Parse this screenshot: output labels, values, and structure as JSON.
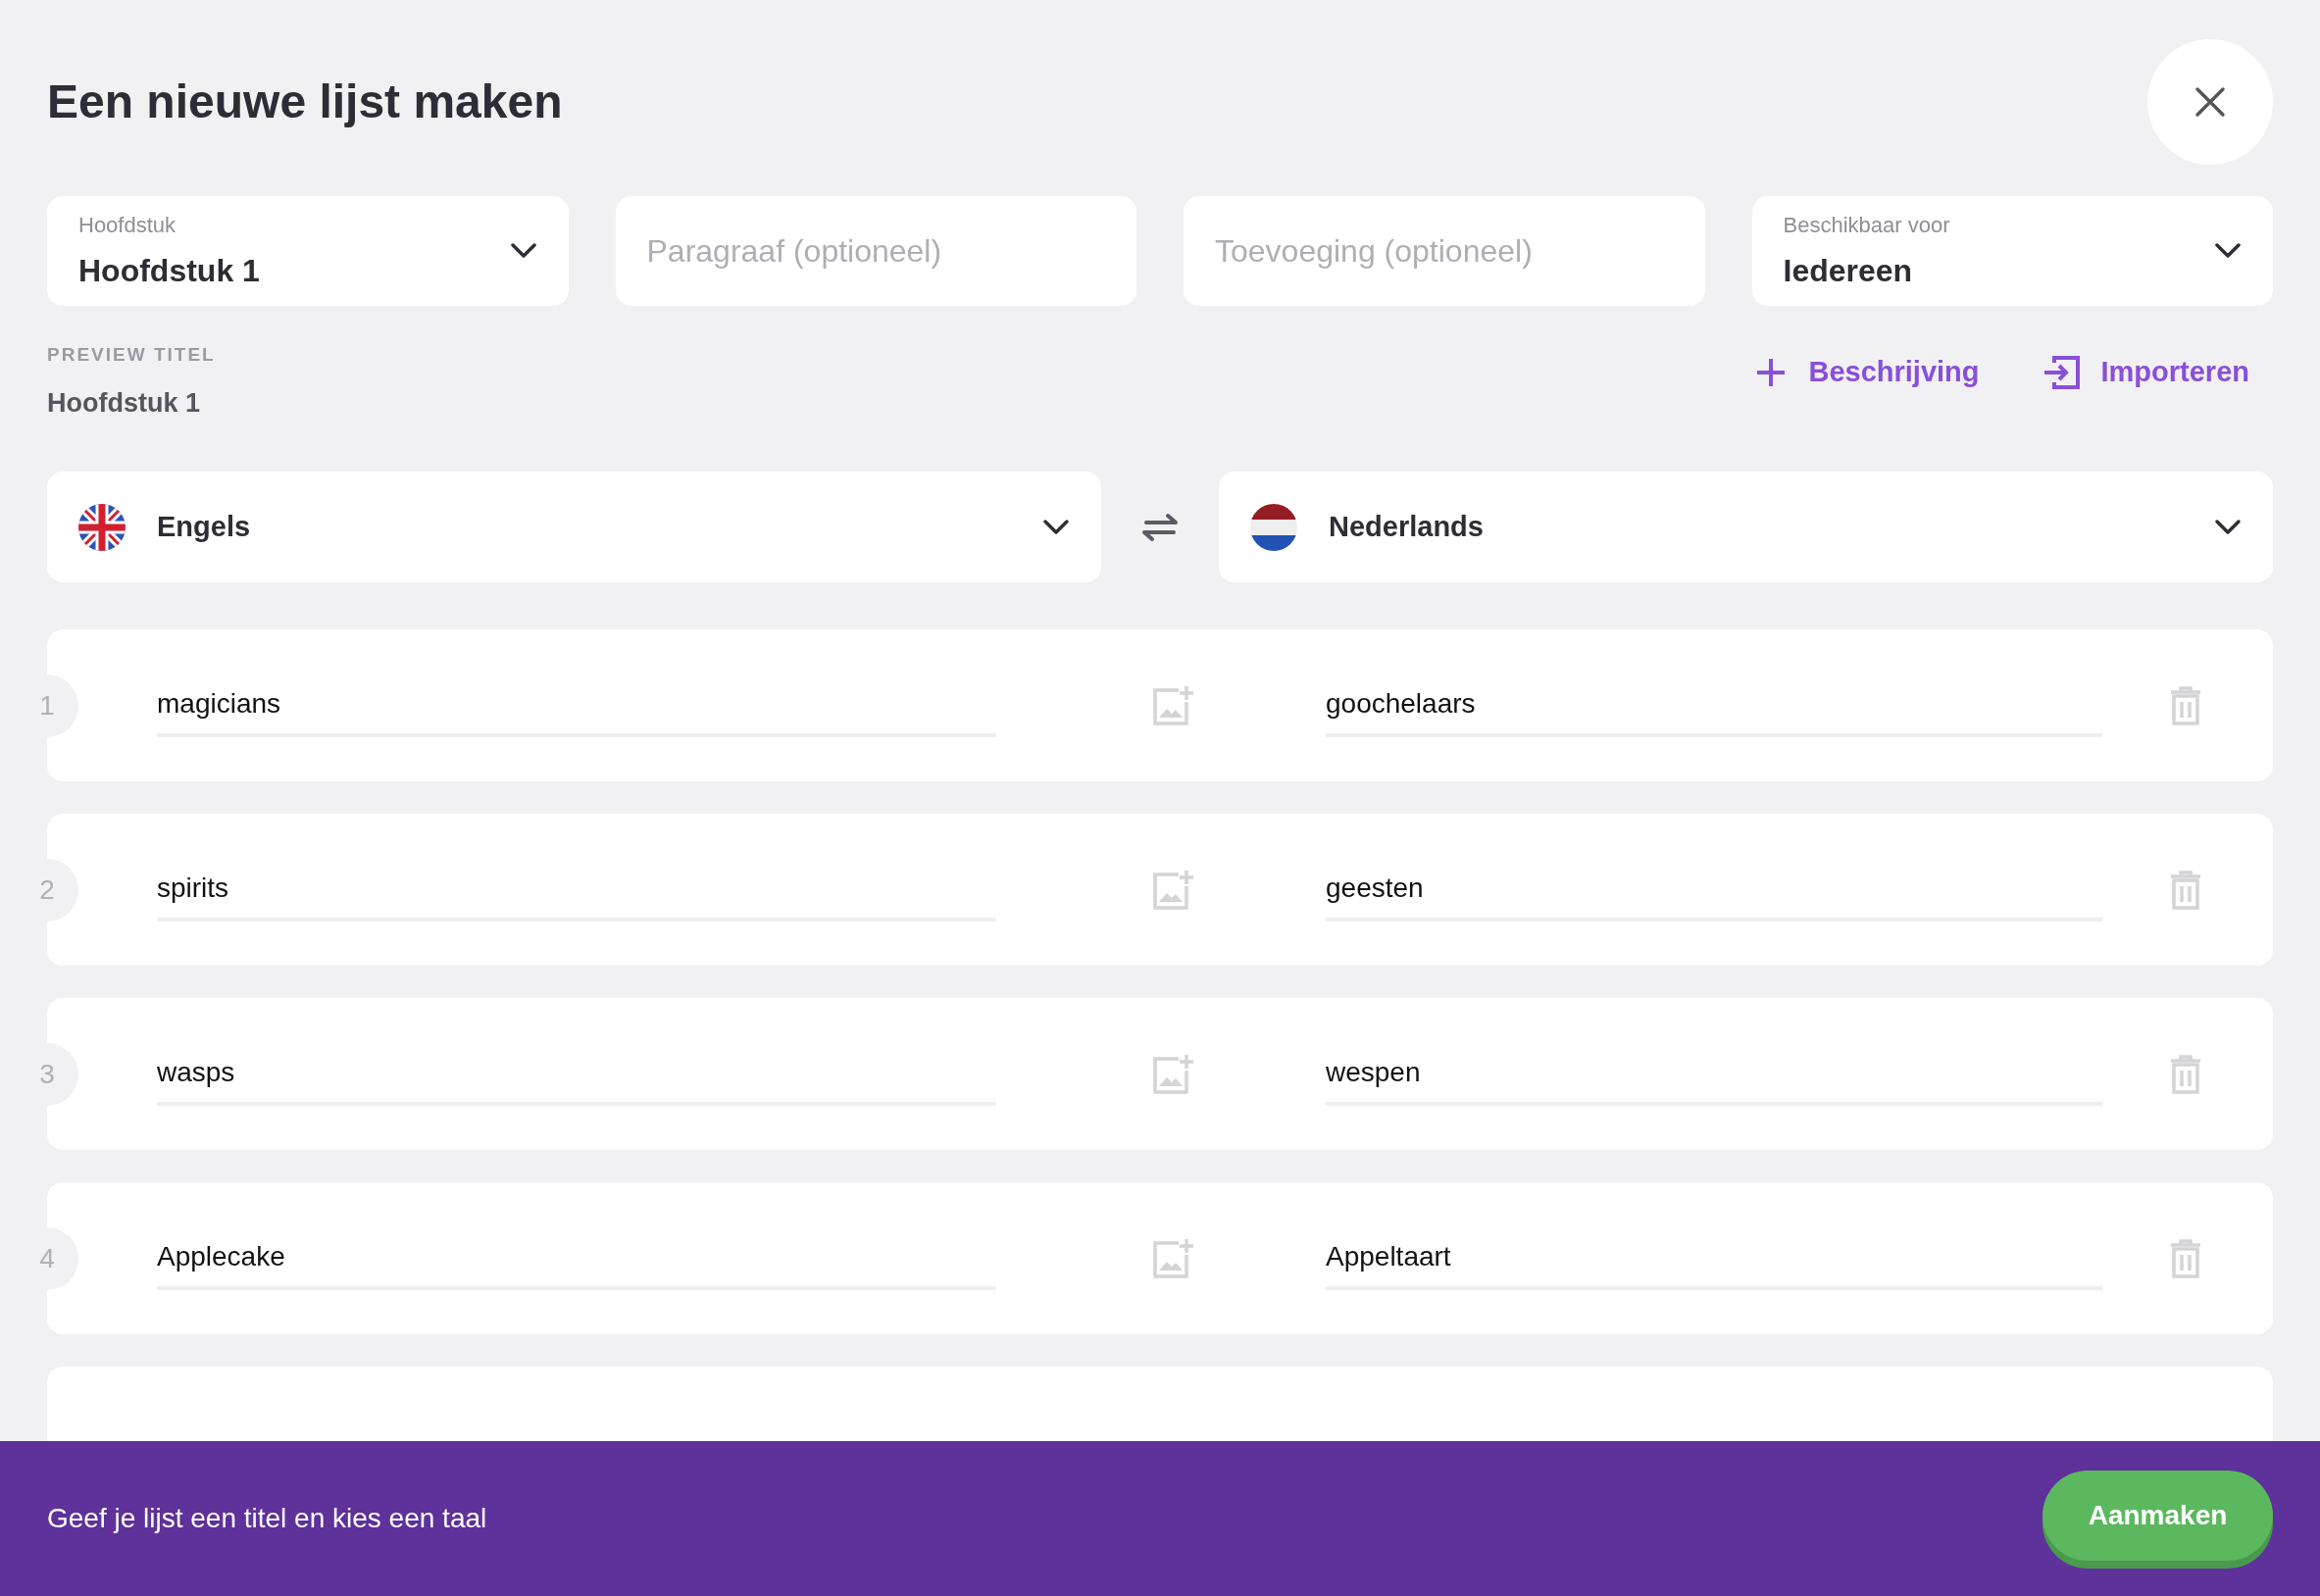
{
  "title": "Een nieuwe lijst maken",
  "fields": [
    {
      "kind": "select",
      "label": "Hoofdstuk",
      "value": "Hoofdstuk 1"
    },
    {
      "kind": "text",
      "placeholder": "Paragraaf (optioneel)"
    },
    {
      "kind": "text",
      "placeholder": "Toevoeging (optioneel)"
    },
    {
      "kind": "select",
      "label": "Beschikbaar voor",
      "value": "Iedereen"
    }
  ],
  "preview": {
    "label": "PREVIEW TITEL",
    "value": "Hoofdstuk 1"
  },
  "actions": [
    {
      "kind": "add",
      "label": "Beschrijving"
    },
    {
      "kind": "import",
      "label": "Importeren"
    }
  ],
  "languages": [
    {
      "kind": "uk",
      "name": "Engels"
    },
    {
      "kind": "nl",
      "name": "Nederlands"
    }
  ],
  "rows": [
    {
      "number": "1",
      "word": "magicians",
      "meaning": "goochelaars"
    },
    {
      "number": "2",
      "word": "spirits",
      "meaning": "geesten"
    },
    {
      "number": "3",
      "word": "wasps",
      "meaning": "wespen"
    },
    {
      "number": "4",
      "word": "Applecake",
      "meaning": "Appeltaart"
    },
    {
      "kind": "partial"
    }
  ],
  "footer": {
    "message": "Geef je lijst een titel en kies een taal",
    "button": "Aanmaken"
  }
}
